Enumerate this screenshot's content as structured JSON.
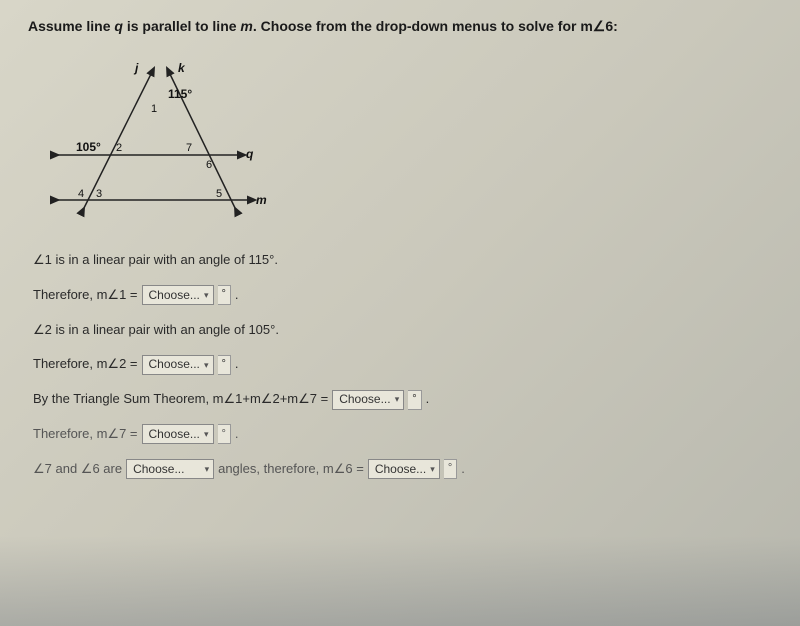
{
  "prompt_part1": "Assume line ",
  "prompt_q": "q",
  "prompt_part2": " is parallel to line ",
  "prompt_m": "m",
  "prompt_part3": ". Choose from the drop-down menus to solve for m∠6:",
  "diagram": {
    "label_j": "j",
    "label_k": "k",
    "label_q": "q",
    "label_m": "m",
    "angle_115": "115°",
    "angle_105": "105°",
    "num_1": "1",
    "num_2": "2",
    "num_3": "3",
    "num_4": "4",
    "num_5": "5",
    "num_6": "6",
    "num_7": "7"
  },
  "lines": {
    "l1": "∠1 is in a linear pair with an angle of 115°.",
    "l2_pre": "Therefore, m∠1 =",
    "l3": "∠2 is in a linear pair with an angle of 105°.",
    "l4_pre": "Therefore, m∠2 =",
    "l5_pre": "By the Triangle Sum Theorem, m∠1+m∠2+m∠7 =",
    "l6_pre": "Therefore, m∠7 =",
    "l7_pre": "∠7 and ∠6 are",
    "l7_mid": "angles, therefore, m∠6 ="
  },
  "dropdown_placeholder": "Choose...",
  "degree_symbol": "°",
  "period": "."
}
